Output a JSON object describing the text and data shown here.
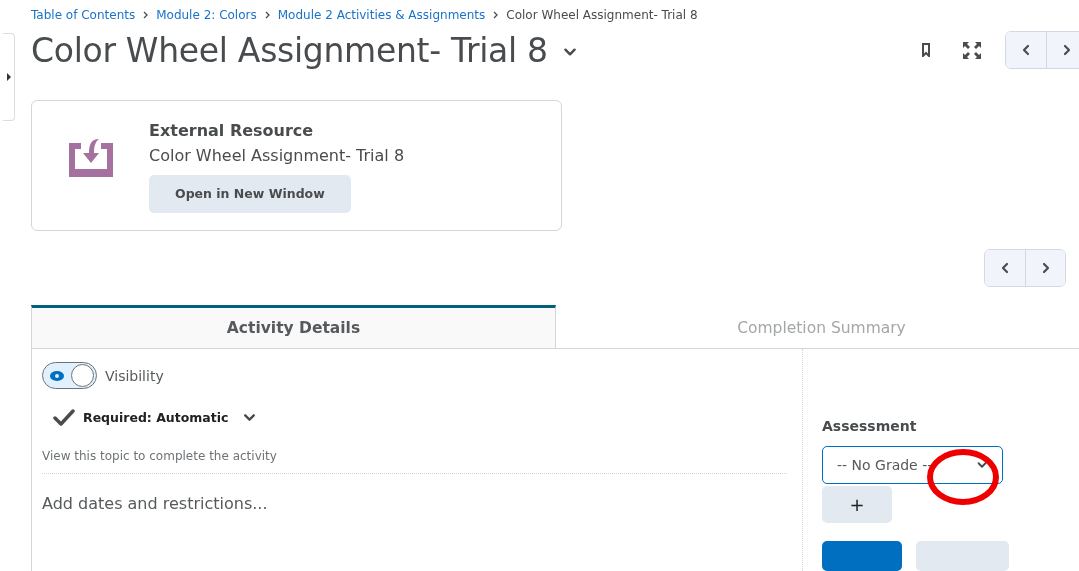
{
  "breadcrumbs": [
    {
      "label": "Table of Contents",
      "kind": "link"
    },
    {
      "label": "Module 2: Colors",
      "kind": "link"
    },
    {
      "label": "Module 2 Activities & Assignments",
      "kind": "link"
    },
    {
      "label": "Color Wheel Assignment- Trial 8",
      "kind": "current"
    }
  ],
  "title": "Color Wheel Assignment- Trial 8",
  "resource_card": {
    "heading": "External Resource",
    "name": "Color Wheel Assignment- Trial 8",
    "button": "Open in New Window"
  },
  "tabs": [
    {
      "label": "Activity Details",
      "selected": true
    },
    {
      "label": "Completion Summary",
      "selected": false
    }
  ],
  "visibility": {
    "label": "Visibility",
    "on": true
  },
  "requirement": {
    "label": "Required: Automatic",
    "description": "View this topic to complete the activity"
  },
  "dates_link": "Add dates and restrictions...",
  "assessment": {
    "label": "Assessment",
    "value": "-- No Grade --",
    "add_button": "+",
    "annotated": true
  }
}
